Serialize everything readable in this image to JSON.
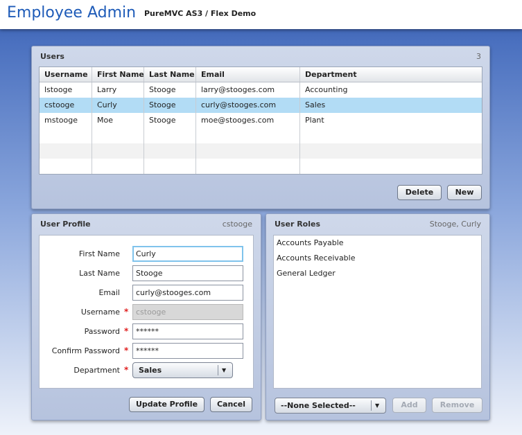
{
  "header": {
    "title": "Employee Admin",
    "subtitle": "PureMVC AS3 / Flex Demo"
  },
  "users_panel": {
    "title": "Users",
    "count": "3",
    "columns": [
      "Username",
      "First Name",
      "Last Name",
      "Email",
      "Department"
    ],
    "rows": [
      [
        "lstooge",
        "Larry",
        "Stooge",
        "larry@stooges.com",
        "Accounting"
      ],
      [
        "cstooge",
        "Curly",
        "Stooge",
        "curly@stooges.com",
        "Sales"
      ],
      [
        "mstooge",
        "Moe",
        "Stooge",
        "moe@stooges.com",
        "Plant"
      ]
    ],
    "selected_row": 1,
    "delete_label": "Delete",
    "new_label": "New"
  },
  "profile_panel": {
    "title": "User Profile",
    "status": "cstooge",
    "fields": {
      "first_name": {
        "label": "First Name",
        "value": "Curly"
      },
      "last_name": {
        "label": "Last Name",
        "value": "Stooge"
      },
      "email": {
        "label": "Email",
        "value": "curly@stooges.com"
      },
      "username": {
        "label": "Username",
        "value": "cstooge"
      },
      "password": {
        "label": "Password",
        "value": "******"
      },
      "confirm_password": {
        "label": "Confirm Password",
        "value": "******"
      },
      "department": {
        "label": "Department",
        "value": "Sales"
      }
    },
    "required_marker": "*",
    "update_label": "Update Profile",
    "cancel_label": "Cancel"
  },
  "roles_panel": {
    "title": "User Roles",
    "status": "Stooge, Curly",
    "roles": [
      "Accounts Payable",
      "Accounts Receivable",
      "General Ledger"
    ],
    "role_combo_value": "--None Selected--",
    "add_label": "Add",
    "remove_label": "Remove"
  },
  "icons": {
    "dropdown": "chevron-down-icon",
    "required": "asterisk-icon"
  },
  "colors": {
    "accent": "#1e5bb8",
    "selection": "#b2dcf5",
    "required": "#e02020",
    "focus": "#7fc3ec"
  }
}
